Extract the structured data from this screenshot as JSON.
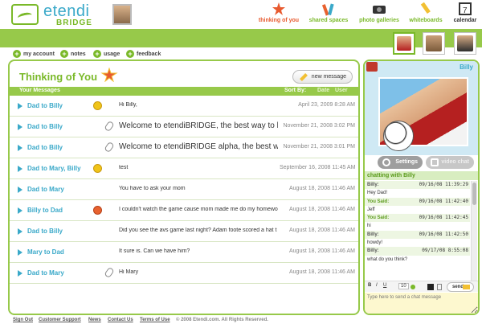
{
  "brand": {
    "name": "etendi",
    "sub": "BRIDGE"
  },
  "nav": [
    {
      "label": "thinking of you",
      "icon": "star-icon",
      "color": "#e85a2f"
    },
    {
      "label": "shared spaces",
      "icon": "pencils-icon",
      "color": "#7ab929"
    },
    {
      "label": "photo galleries",
      "icon": "camera-icon",
      "color": "#7ab929"
    },
    {
      "label": "whiteboards",
      "icon": "marker-icon",
      "color": "#7ab929"
    },
    {
      "label": "calendar",
      "icon": "calendar-icon",
      "color": "#333333"
    }
  ],
  "sublinks": [
    "my account",
    "notes",
    "usage",
    "feedback"
  ],
  "main": {
    "title": "Thinking of You",
    "new_message": "new message",
    "col_messages": "Your Messages",
    "sort_by": "Sort By:",
    "sort_date": "Date",
    "sort_user": "User",
    "rows": [
      {
        "from": "Dad to Billy",
        "icon": "smile-icon",
        "subject": "Hi Billy,",
        "date": "April 23, 2009 8:28 AM",
        "big": false
      },
      {
        "from": "Dad to Billy",
        "icon": "paperclip-icon",
        "subject": "Welcome to etendiBRIDGE, the best way to bridge the gap",
        "date": "November 21, 2008 3:02 PM",
        "big": true
      },
      {
        "from": "Dad to Billy",
        "icon": "paperclip-icon",
        "subject": "Welcome to etendiBRIDGE alpha, the best way to bridge t",
        "date": "November 21, 2008 3:01 PM",
        "big": true
      },
      {
        "from": "Dad to Mary, Billy",
        "icon": "smile-icon",
        "subject": "test",
        "date": "September 16, 2008 11:45 AM",
        "big": false
      },
      {
        "from": "Dad to Mary",
        "icon": "",
        "subject": "You have to ask your mom",
        "date": "August 18, 2008 11:46 AM",
        "big": false
      },
      {
        "from": "Billy to Dad",
        "icon": "sad-icon",
        "subject": "I couldn't watch the game cause mom made me do my homework",
        "date": "August 18, 2008 11:46 AM",
        "big": false
      },
      {
        "from": "Dad to Billy",
        "icon": "",
        "subject": "Did you see the avs game last night? Adam foote scored a hat t",
        "date": "August 18, 2008 11:46 AM",
        "big": false
      },
      {
        "from": "Mary to Dad",
        "icon": "",
        "subject": "It sure is.  Can we have him?",
        "date": "August 18, 2008 11:46 AM",
        "big": false
      },
      {
        "from": "Dad to Mary",
        "icon": "paperclip-icon",
        "subject": "Hi Mary",
        "date": "August 18, 2008 11:46 AM",
        "big": false
      }
    ]
  },
  "chat": {
    "name": "Billy",
    "settings": "Settings",
    "video_chat": "video chat",
    "chatting_with": "chatting with Billy",
    "log": [
      {
        "who": "Billy:",
        "ts": "09/16/08 11:39:29",
        "msg": "Hey Dad!"
      },
      {
        "who": "You Said:",
        "ts": "09/16/08 11:42:40",
        "msg": "Jeff"
      },
      {
        "who": "You Said:",
        "ts": "09/16/08 11:42:45",
        "msg": "hi"
      },
      {
        "who": "Billy:",
        "ts": "09/16/08 11:42:50",
        "msg": "howdy!"
      },
      {
        "who": "Billy:",
        "ts": "09/17/08 8:55:08",
        "msg": "what do you think?"
      }
    ],
    "font_size": "10",
    "send": "send",
    "input_placeholder": "Type here to send a chat message"
  },
  "footer": [
    "Sign Out",
    "Customer Support",
    "News",
    "Contact Us",
    "Terms of Use",
    "© 2008 Etendi.com. All Rights Reserved."
  ],
  "colors": {
    "accent_green": "#97c94a",
    "link_blue": "#3aa9c9"
  }
}
